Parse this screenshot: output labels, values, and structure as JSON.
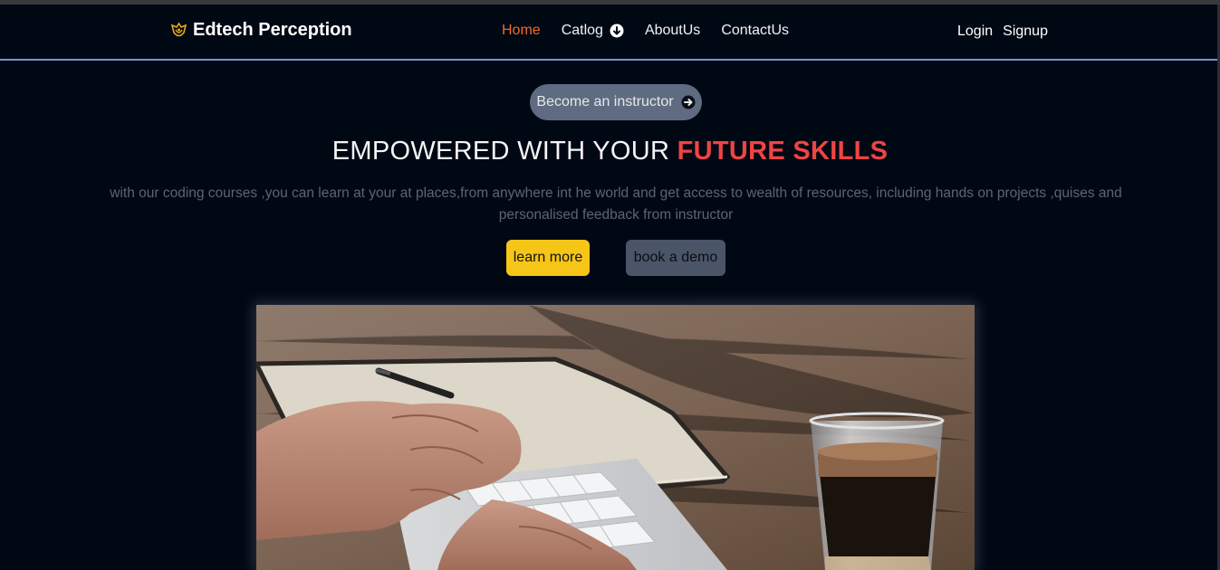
{
  "brand": {
    "name": "Edtech Perception",
    "logo_icon": "crest-icon",
    "logo_color": "#e5a81a"
  },
  "nav": {
    "links": [
      {
        "label": "Home",
        "active": true
      },
      {
        "label": "Catlog",
        "has_dropdown": true
      },
      {
        "label": "AboutUs"
      },
      {
        "label": "ContactUs"
      }
    ],
    "dropdown_icon": "arrow-circle-down-icon",
    "active_color": "#ef6b2a"
  },
  "auth": {
    "login": "Login",
    "signup": "Signup"
  },
  "hero": {
    "instructor_button": "Become an instructor",
    "instructor_icon": "arrow-circle-right-icon",
    "headline_plain": "EMPOWERED WITH YOUR",
    "headline_accent": "FUTURE SKILLS",
    "accent_color": "#ef4444",
    "description": "with our coding courses ,you can learn at your at places,from anywhere int he world and get access to wealth of resources, including hands on projects ,quises and personalised feedback from instructor",
    "learn_more": "learn more",
    "book_demo": "book a demo",
    "image_subject": "hands typing on keyboard with notebook and coffee glass"
  },
  "colors": {
    "background": "#000814",
    "yellow": "#f5c518",
    "nav_border": "#7d8fcf"
  }
}
